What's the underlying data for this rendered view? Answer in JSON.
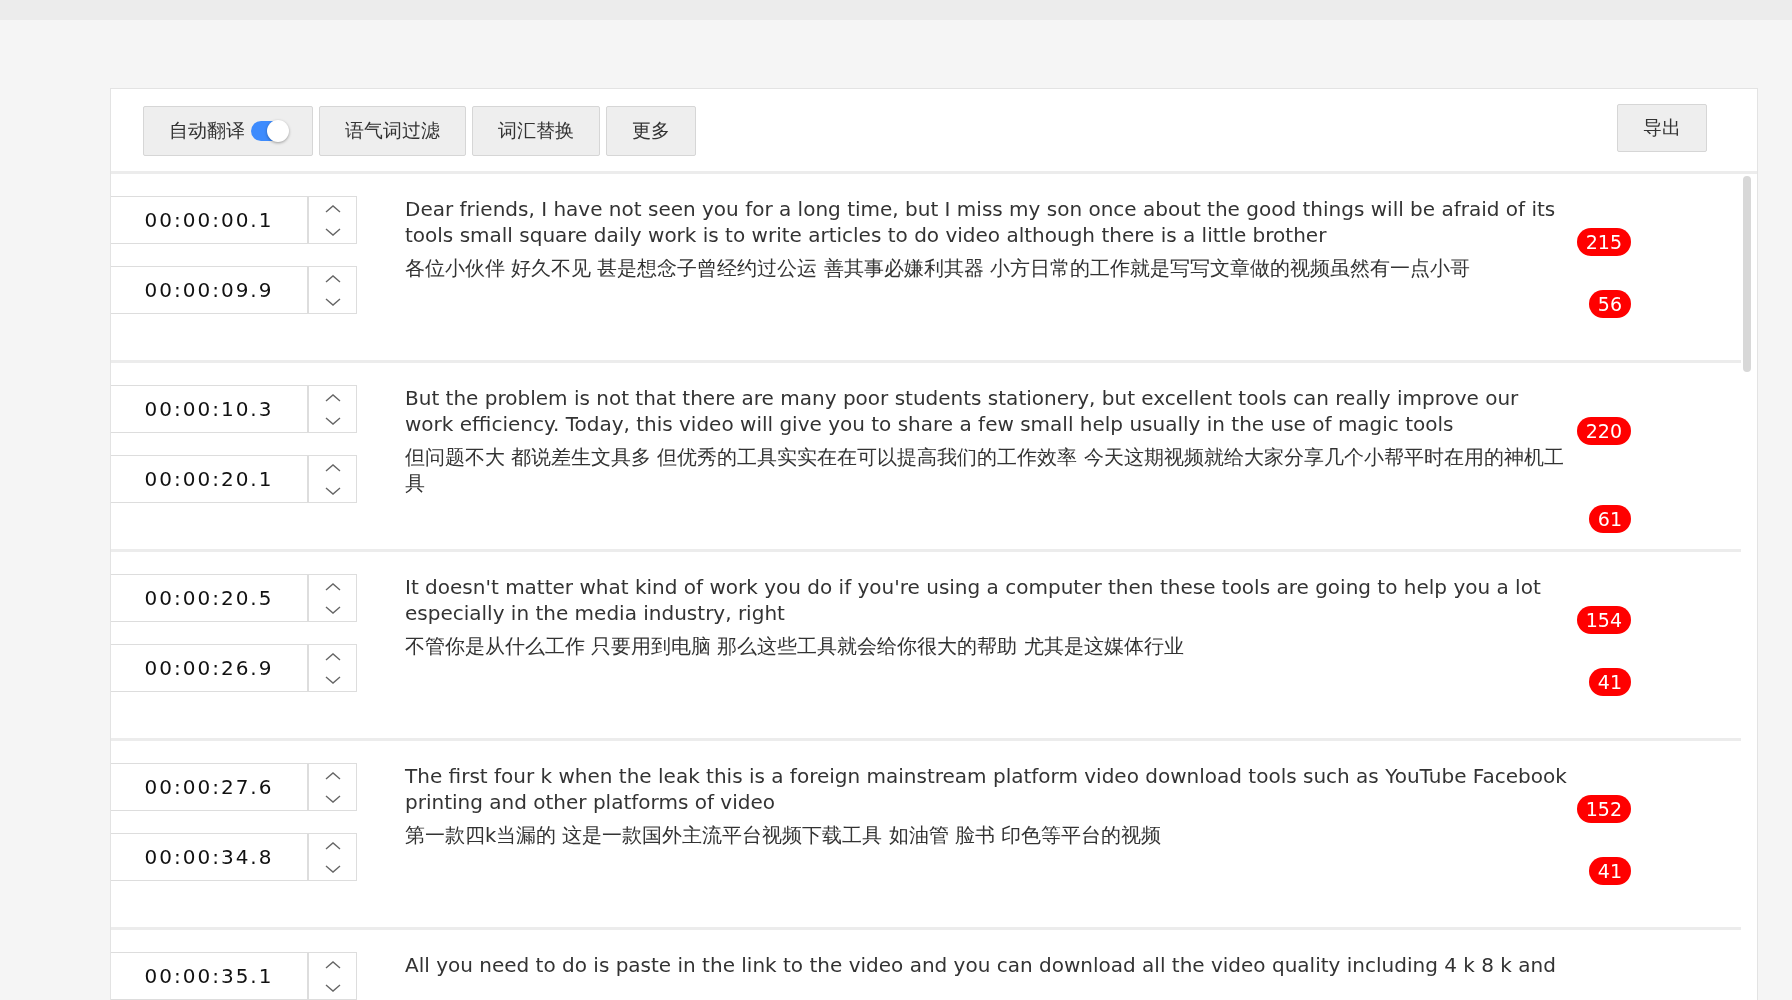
{
  "toolbar": {
    "buttons": [
      {
        "label": "自动翻译",
        "kind": "toggle",
        "on": true
      },
      {
        "label": "语气词过滤",
        "kind": "button"
      },
      {
        "label": "词汇替换",
        "kind": "button"
      },
      {
        "label": "更多",
        "kind": "button"
      }
    ],
    "export_button": "导出"
  },
  "subtitles": [
    {
      "start": "00:00:00.1",
      "end": "00:00:09.9",
      "english": "Dear friends, I have not seen you for a long time, but I miss my son once about the good things will be afraid of its tools small square daily work is to write articles to do video although there is a little brother",
      "english_count": "215",
      "chinese": "各位小伙伴 好久不见 甚是想念子曾经约过公运 善其事必嫌利其器 小方日常的工作就是写写文章做的视频虽然有一点小哥",
      "chinese_count": "56"
    },
    {
      "start": "00:00:10.3",
      "end": "00:00:20.1",
      "english": "But the problem is not that there are many poor students stationery, but excellent tools can really improve our work efficiency. Today, this video will give you to share a few small help usually in the use of magic tools",
      "english_count": "220",
      "chinese": "但问题不大 都说差生文具多 但优秀的工具实实在在可以提高我们的工作效率 今天这期视频就给大家分享几个小帮平时在用的神机工具",
      "chinese_count": "61"
    },
    {
      "start": "00:00:20.5",
      "end": "00:00:26.9",
      "english": "It doesn't matter what kind of work you do if you're using a computer then these tools are going to help you a lot especially in the media industry, right",
      "english_count": "154",
      "chinese": "不管你是从什么工作 只要用到电脑 那么这些工具就会给你很大的帮助 尤其是这媒体行业",
      "chinese_count": "41"
    },
    {
      "start": "00:00:27.6",
      "end": "00:00:34.8",
      "english": "The first four k when the leak this is a foreign mainstream platform video download tools such as YouTube Facebook printing and other platforms of video",
      "english_count": "152",
      "chinese": "第一款四k当漏的 这是一款国外主流平台视频下载工具 如油管 脸书 印色等平台的视频",
      "chinese_count": "41"
    },
    {
      "start": "00:00:35.1",
      "english": "All you need to do is paste in the link to the video and you can download all the video quality including 4 k 8 k and"
    }
  ]
}
